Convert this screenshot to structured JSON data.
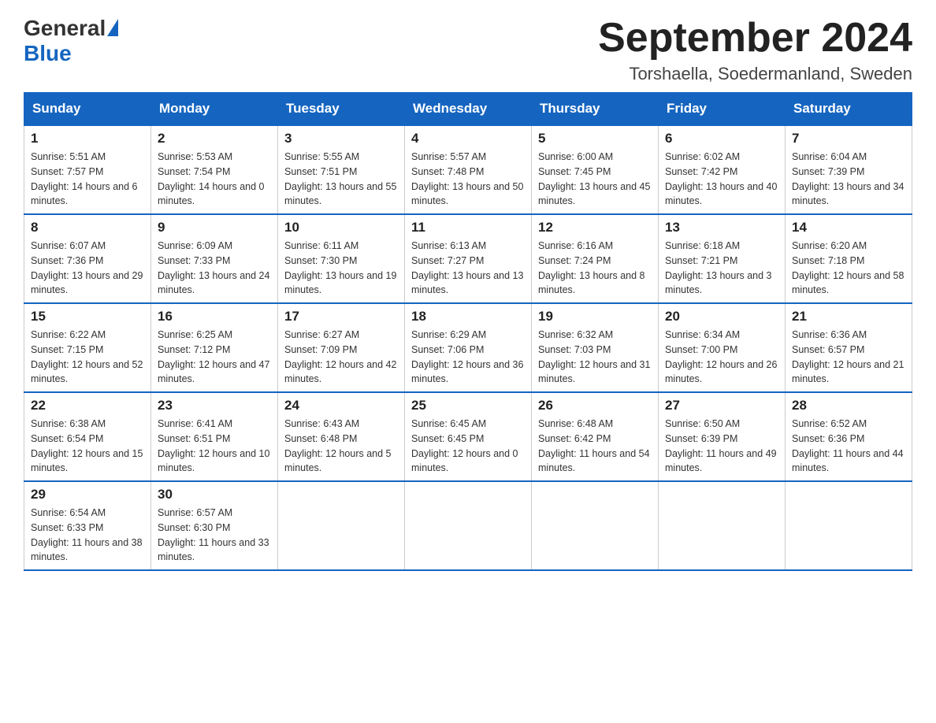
{
  "header": {
    "logo_general": "General",
    "logo_blue": "Blue",
    "month_title": "September 2024",
    "location": "Torshaella, Soedermanland, Sweden"
  },
  "weekdays": [
    "Sunday",
    "Monday",
    "Tuesday",
    "Wednesday",
    "Thursday",
    "Friday",
    "Saturday"
  ],
  "weeks": [
    [
      {
        "day": "1",
        "sunrise": "5:51 AM",
        "sunset": "7:57 PM",
        "daylight": "14 hours and 6 minutes."
      },
      {
        "day": "2",
        "sunrise": "5:53 AM",
        "sunset": "7:54 PM",
        "daylight": "14 hours and 0 minutes."
      },
      {
        "day": "3",
        "sunrise": "5:55 AM",
        "sunset": "7:51 PM",
        "daylight": "13 hours and 55 minutes."
      },
      {
        "day": "4",
        "sunrise": "5:57 AM",
        "sunset": "7:48 PM",
        "daylight": "13 hours and 50 minutes."
      },
      {
        "day": "5",
        "sunrise": "6:00 AM",
        "sunset": "7:45 PM",
        "daylight": "13 hours and 45 minutes."
      },
      {
        "day": "6",
        "sunrise": "6:02 AM",
        "sunset": "7:42 PM",
        "daylight": "13 hours and 40 minutes."
      },
      {
        "day": "7",
        "sunrise": "6:04 AM",
        "sunset": "7:39 PM",
        "daylight": "13 hours and 34 minutes."
      }
    ],
    [
      {
        "day": "8",
        "sunrise": "6:07 AM",
        "sunset": "7:36 PM",
        "daylight": "13 hours and 29 minutes."
      },
      {
        "day": "9",
        "sunrise": "6:09 AM",
        "sunset": "7:33 PM",
        "daylight": "13 hours and 24 minutes."
      },
      {
        "day": "10",
        "sunrise": "6:11 AM",
        "sunset": "7:30 PM",
        "daylight": "13 hours and 19 minutes."
      },
      {
        "day": "11",
        "sunrise": "6:13 AM",
        "sunset": "7:27 PM",
        "daylight": "13 hours and 13 minutes."
      },
      {
        "day": "12",
        "sunrise": "6:16 AM",
        "sunset": "7:24 PM",
        "daylight": "13 hours and 8 minutes."
      },
      {
        "day": "13",
        "sunrise": "6:18 AM",
        "sunset": "7:21 PM",
        "daylight": "13 hours and 3 minutes."
      },
      {
        "day": "14",
        "sunrise": "6:20 AM",
        "sunset": "7:18 PM",
        "daylight": "12 hours and 58 minutes."
      }
    ],
    [
      {
        "day": "15",
        "sunrise": "6:22 AM",
        "sunset": "7:15 PM",
        "daylight": "12 hours and 52 minutes."
      },
      {
        "day": "16",
        "sunrise": "6:25 AM",
        "sunset": "7:12 PM",
        "daylight": "12 hours and 47 minutes."
      },
      {
        "day": "17",
        "sunrise": "6:27 AM",
        "sunset": "7:09 PM",
        "daylight": "12 hours and 42 minutes."
      },
      {
        "day": "18",
        "sunrise": "6:29 AM",
        "sunset": "7:06 PM",
        "daylight": "12 hours and 36 minutes."
      },
      {
        "day": "19",
        "sunrise": "6:32 AM",
        "sunset": "7:03 PM",
        "daylight": "12 hours and 31 minutes."
      },
      {
        "day": "20",
        "sunrise": "6:34 AM",
        "sunset": "7:00 PM",
        "daylight": "12 hours and 26 minutes."
      },
      {
        "day": "21",
        "sunrise": "6:36 AM",
        "sunset": "6:57 PM",
        "daylight": "12 hours and 21 minutes."
      }
    ],
    [
      {
        "day": "22",
        "sunrise": "6:38 AM",
        "sunset": "6:54 PM",
        "daylight": "12 hours and 15 minutes."
      },
      {
        "day": "23",
        "sunrise": "6:41 AM",
        "sunset": "6:51 PM",
        "daylight": "12 hours and 10 minutes."
      },
      {
        "day": "24",
        "sunrise": "6:43 AM",
        "sunset": "6:48 PM",
        "daylight": "12 hours and 5 minutes."
      },
      {
        "day": "25",
        "sunrise": "6:45 AM",
        "sunset": "6:45 PM",
        "daylight": "12 hours and 0 minutes."
      },
      {
        "day": "26",
        "sunrise": "6:48 AM",
        "sunset": "6:42 PM",
        "daylight": "11 hours and 54 minutes."
      },
      {
        "day": "27",
        "sunrise": "6:50 AM",
        "sunset": "6:39 PM",
        "daylight": "11 hours and 49 minutes."
      },
      {
        "day": "28",
        "sunrise": "6:52 AM",
        "sunset": "6:36 PM",
        "daylight": "11 hours and 44 minutes."
      }
    ],
    [
      {
        "day": "29",
        "sunrise": "6:54 AM",
        "sunset": "6:33 PM",
        "daylight": "11 hours and 38 minutes."
      },
      {
        "day": "30",
        "sunrise": "6:57 AM",
        "sunset": "6:30 PM",
        "daylight": "11 hours and 33 minutes."
      },
      null,
      null,
      null,
      null,
      null
    ]
  ]
}
